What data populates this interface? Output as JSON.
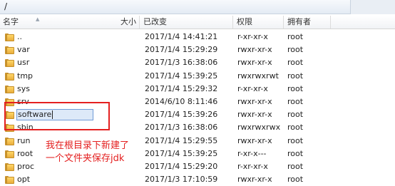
{
  "path": "/",
  "columns": {
    "name": "名字",
    "size": "大小",
    "modified": "已改变",
    "permissions": "权限",
    "owner": "拥有者"
  },
  "files": [
    {
      "name": "..",
      "modified": "2017/1/4 14:41:21",
      "permissions": "r-xr-xr-x",
      "owner": "root"
    },
    {
      "name": "var",
      "modified": "2017/1/4 15:29:29",
      "permissions": "rwxr-xr-x",
      "owner": "root"
    },
    {
      "name": "usr",
      "modified": "2017/1/3 16:38:06",
      "permissions": "rwxr-xr-x",
      "owner": "root"
    },
    {
      "name": "tmp",
      "modified": "2017/1/4 15:39:25",
      "permissions": "rwxrwxrwt",
      "owner": "root"
    },
    {
      "name": "sys",
      "modified": "2017/1/4 15:29:32",
      "permissions": "r-xr-xr-x",
      "owner": "root"
    },
    {
      "name": "srv",
      "modified": "2014/6/10 8:11:46",
      "permissions": "rwxr-xr-x",
      "owner": "root"
    },
    {
      "name": "software",
      "modified": "2017/1/4 15:39:26",
      "permissions": "rwxr-xr-x",
      "owner": "root",
      "editing": true
    },
    {
      "name": "sbin",
      "modified": "2017/1/3 16:38:06",
      "permissions": "rwxrwxrwx",
      "owner": "root"
    },
    {
      "name": "run",
      "modified": "2017/1/4 15:29:55",
      "permissions": "rwxr-xr-x",
      "owner": "root"
    },
    {
      "name": "root",
      "modified": "2017/1/4 15:39:25",
      "permissions": "r-xr-x---",
      "owner": "root"
    },
    {
      "name": "proc",
      "modified": "2017/1/4 15:29:20",
      "permissions": "r-xr-xr-x",
      "owner": "root"
    },
    {
      "name": "opt",
      "modified": "2017/1/3 17:10:59",
      "permissions": "rwxr-xr-x",
      "owner": "root"
    }
  ],
  "annotation": {
    "line1": "我在根目录下新建了",
    "line2": "一个文件夹保存jdk",
    "color": "#e42020"
  },
  "icons": {
    "folder": "folder-icon",
    "sort": "sort-arrow-icon"
  }
}
